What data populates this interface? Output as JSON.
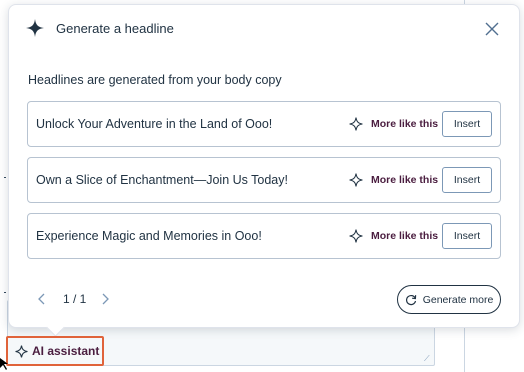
{
  "popover": {
    "title": "Generate a headline",
    "subtitle": "Headlines are generated from your body copy",
    "close_icon": "close-icon",
    "title_icon": "sparkle-icon"
  },
  "suggestions": [
    {
      "text": "Unlock Your Adventure in the Land of Ooo!",
      "more_label": "More like this",
      "insert_label": "Insert"
    },
    {
      "text": "Own a Slice of Enchantment—Join Us Today!",
      "more_label": "More like this",
      "insert_label": "Insert"
    },
    {
      "text": "Experience Magic and Memories in Ooo!",
      "more_label": "More like this",
      "insert_label": "Insert"
    }
  ],
  "pager": {
    "count": "1 / 1"
  },
  "generate_more": {
    "label": "Generate more",
    "icon": "refresh-icon"
  },
  "ai_assistant": {
    "label": "AI assistant",
    "icon": "sparkle-icon"
  },
  "colors": {
    "accent": "#4a1d3f",
    "highlight_border": "#e0633a",
    "text": "#213343",
    "border": "#b7c3d1"
  }
}
